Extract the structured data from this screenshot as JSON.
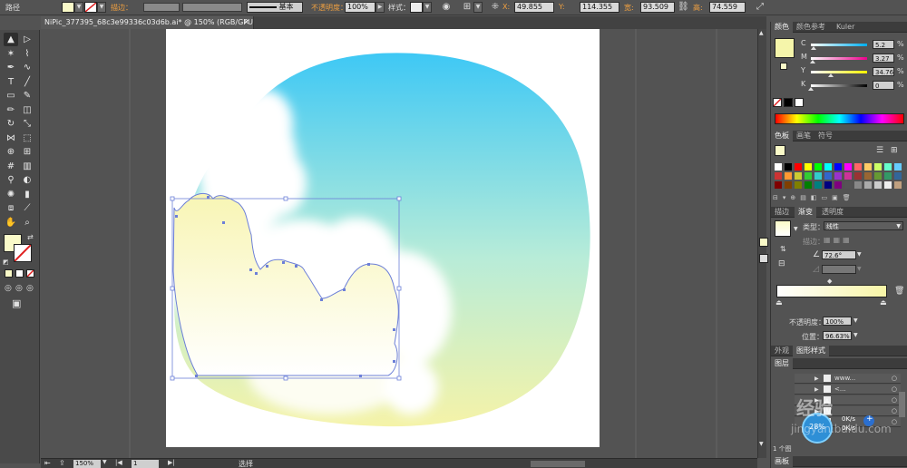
{
  "control_bar": {
    "mode_label": "路径",
    "fill_color": "#fafac8",
    "stroke_label": "描边：",
    "profile_label": "基本",
    "opacity_label": "不透明度：",
    "opacity_value": "100%",
    "style_label": "样式：",
    "x_label": "X:",
    "x_value": "49.855",
    "y_label": "Y:",
    "y_value": "114.355",
    "w_label": "宽:",
    "w_value": "93.509",
    "h_label": "高:",
    "h_value": "74.559"
  },
  "document_tab": {
    "title": "NiPic_377395_68c3e99336c03d6b.ai* @ 150% (RGB/GPU 预览)"
  },
  "tools": [
    {
      "icon": "selection-arrow-icon",
      "glyph": "▲"
    },
    {
      "icon": "direct-selection-icon",
      "glyph": "▷"
    },
    {
      "icon": "magic-wand-icon",
      "glyph": "✶"
    },
    {
      "icon": "lasso-icon",
      "glyph": "⌇"
    },
    {
      "icon": "pen-icon",
      "glyph": "✒"
    },
    {
      "icon": "curvature-icon",
      "glyph": "∿"
    },
    {
      "icon": "type-icon",
      "glyph": "T"
    },
    {
      "icon": "line-icon",
      "glyph": "╱"
    },
    {
      "icon": "rectangle-icon",
      "glyph": "▭"
    },
    {
      "icon": "paintbrush-icon",
      "glyph": "✎"
    },
    {
      "icon": "pencil-icon",
      "glyph": "✏"
    },
    {
      "icon": "eraser-icon",
      "glyph": "◫"
    },
    {
      "icon": "rotate-icon",
      "glyph": "↻"
    },
    {
      "icon": "scale-icon",
      "glyph": "⤡"
    },
    {
      "icon": "width-icon",
      "glyph": "⋈"
    },
    {
      "icon": "free-transform-icon",
      "glyph": "⬚"
    },
    {
      "icon": "shape-builder-icon",
      "glyph": "⊕"
    },
    {
      "icon": "perspective-grid-icon",
      "glyph": "⊞"
    },
    {
      "icon": "mesh-icon",
      "glyph": "#"
    },
    {
      "icon": "gradient-icon",
      "glyph": "▥"
    },
    {
      "icon": "eyedropper-icon",
      "glyph": "⚲"
    },
    {
      "icon": "blend-icon",
      "glyph": "◐"
    },
    {
      "icon": "symbol-sprayer-icon",
      "glyph": "✺"
    },
    {
      "icon": "column-graph-icon",
      "glyph": "▮"
    },
    {
      "icon": "artboard-icon",
      "glyph": "⧈"
    },
    {
      "icon": "slice-icon",
      "glyph": "⟋"
    },
    {
      "icon": "hand-icon",
      "glyph": "✋"
    },
    {
      "icon": "zoom-icon",
      "glyph": "⌕"
    }
  ],
  "status_bar": {
    "zoom": "150%",
    "artboard_number": "1",
    "tool_name": "选择"
  },
  "color_panel": {
    "tabs": [
      "颜色",
      "颜色参考",
      "Kuler"
    ],
    "swatch_color": "#f5f5aa",
    "channels": [
      {
        "label": "C",
        "value": "5.2",
        "unit": "%",
        "position": 0.052,
        "gradient_end": "#00aeef"
      },
      {
        "label": "M",
        "value": "3.27",
        "unit": "%",
        "position": 0.0327,
        "gradient_end": "#ec008c"
      },
      {
        "label": "Y",
        "value": "34.76",
        "unit": "%",
        "position": 0.3476,
        "gradient_end": "#fff200"
      },
      {
        "label": "K",
        "value": "0",
        "unit": "%",
        "position": 0.0,
        "gradient_end": "#000000"
      }
    ]
  },
  "swatches_panel": {
    "tabs": [
      "色板",
      "画笔",
      "符号"
    ]
  },
  "gradient_panel": {
    "tabs": [
      "描边",
      "渐变",
      "透明度"
    ],
    "type_label": "类型：",
    "type_value": "线性",
    "stroke_label": "描边：",
    "angle_value": "72.6°",
    "opacity_label": "不透明度：",
    "opacity_value": "100%",
    "location_label": "位置：",
    "location_value": "96.63%",
    "bar_color_start": "#ffffff",
    "bar_color_end": "#f8f5a6"
  },
  "appearance_panel": {
    "tabs": [
      "外观",
      "图形样式"
    ]
  },
  "layers_panel": {
    "tab": "图层",
    "layer_names": [
      "www...",
      "<...",
      "",
      "",
      ""
    ],
    "count_label": "1 个图"
  },
  "artboards_panel": {
    "tab": "画板"
  },
  "overlay_widget": {
    "percent": "28%",
    "up_speed": "0K/s",
    "down_speed": "0K/s"
  },
  "watermark": {
    "text_cn": "经验",
    "text_site": "jingyan.baidu.com"
  },
  "artwork": {
    "sky_top": "#3ec8f5",
    "sky_bottom": "#f5f3a8",
    "selection_color": "#6c7fd8"
  }
}
